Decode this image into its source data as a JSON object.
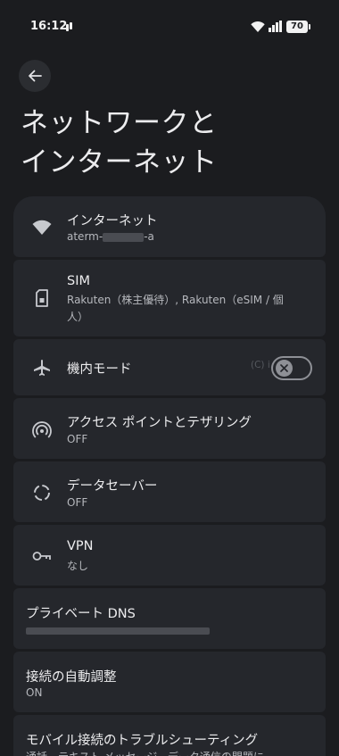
{
  "status_bar": {
    "time": "16:12",
    "battery": "70",
    "icons": [
      "notification-icon",
      "wifi-icon",
      "signal-icon",
      "battery-icon"
    ]
  },
  "header": {
    "back_icon": "arrow-left-icon",
    "title": "ネットワークと\nインターネット"
  },
  "items": [
    {
      "title": "インターネット",
      "subtitle_prefix": "aterm-",
      "subtitle_suffix": "-a",
      "icon": "wifi-icon"
    },
    {
      "title": "SIM",
      "subtitle": "Rakuten（株主優待）, Rakuten（eSIM / 個人）",
      "icon": "sim-card-icon"
    },
    {
      "title": "機内モード",
      "icon": "airplane-icon",
      "toggle": false,
      "watermark": "(C) i...con"
    },
    {
      "title": "アクセス ポイントとテザリング",
      "subtitle": "OFF",
      "icon": "hotspot-icon"
    },
    {
      "title": "データセーバー",
      "subtitle": "OFF",
      "icon": "data-saver-icon"
    },
    {
      "title": "VPN",
      "subtitle": "なし",
      "icon": "vpn-key-icon"
    },
    {
      "title": "プライベート DNS"
    },
    {
      "title": "接続の自動調整",
      "subtitle": "ON"
    },
    {
      "title": "モバイル接続のトラブルシューティング",
      "subtitle": "通話、テキスト メッセージ、データ通信の問題に"
    }
  ],
  "colors": {
    "background": "#1b1c1f",
    "card": "#25272c",
    "text": "#ececee",
    "subtext": "#b6b8bd"
  }
}
